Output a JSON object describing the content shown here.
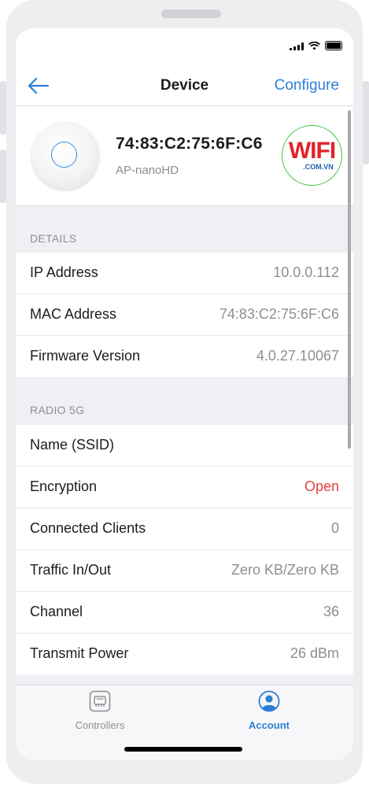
{
  "nav": {
    "title": "Device",
    "action_label": "Configure",
    "back_icon": "arrow-left-icon"
  },
  "device": {
    "name": "74:83:C2:75:6F:C6",
    "model": "AP-nanoHD",
    "watermark": {
      "text": "WIFI",
      "subtext": ".COM.VN"
    }
  },
  "details": {
    "header": "DETAILS",
    "rows": [
      {
        "label": "IP Address",
        "value": "10.0.0.112"
      },
      {
        "label": "MAC Address",
        "value": "74:83:C2:75:6F:C6"
      },
      {
        "label": "Firmware Version",
        "value": "4.0.27.10067"
      }
    ]
  },
  "radio": {
    "header": "RADIO 5G",
    "rows": [
      {
        "label": "Name (SSID)",
        "value": ""
      },
      {
        "label": "Encryption",
        "value": "Open"
      },
      {
        "label": "Connected Clients",
        "value": "0"
      },
      {
        "label": "Traffic In/Out",
        "value": "Zero KB/Zero KB"
      },
      {
        "label": "Channel",
        "value": "36"
      },
      {
        "label": "Transmit Power",
        "value": "26 dBm"
      }
    ]
  },
  "tabs": [
    {
      "label": "Controllers",
      "icon": "controller-icon",
      "active": false
    },
    {
      "label": "Account",
      "icon": "account-icon",
      "active": true
    }
  ],
  "colors": {
    "accent": "#2b7fd6",
    "danger": "#e0433d",
    "secondary_text": "#8e8e93"
  }
}
